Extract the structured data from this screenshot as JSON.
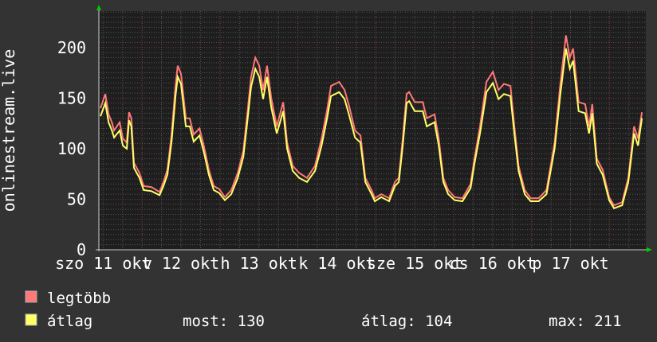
{
  "chart_data": {
    "type": "line",
    "ylabel": "onlinestream.live",
    "ylim": [
      0,
      236
    ],
    "yticks": [
      "0",
      "50",
      "100",
      "150",
      "200"
    ],
    "ytick_values": [
      0,
      50,
      100,
      150,
      200
    ],
    "xunit": "hours since start of graph",
    "xlim": [
      0,
      168.5
    ],
    "day_boundaries_hours": [
      13.3,
      37.3,
      61.3,
      85.3,
      109.3,
      133.3,
      157.3
    ],
    "xticks": [
      "szo 11 okt",
      "v 12 okt",
      "h 13 okt",
      "k 14 okt",
      "sze 15 okt",
      "cs 16 okt",
      "p 17 okt"
    ],
    "xtick_hours": [
      1.3,
      25.3,
      49.3,
      73.3,
      97.3,
      121.3,
      145.3
    ],
    "x": [
      0.5,
      2,
      3,
      4,
      4.7,
      6.4,
      7.4,
      8.6,
      9.3,
      10,
      10.8,
      12.5,
      13.8,
      16.2,
      18.7,
      19.9,
      21.1,
      22.4,
      23.6,
      24.3,
      25.3,
      26.8,
      28,
      29.2,
      31,
      32.4,
      33.9,
      35.4,
      37.1,
      38.8,
      40.8,
      42.8,
      44.5,
      45.7,
      46.9,
      48.2,
      49.4,
      50.6,
      51.8,
      53.1,
      54.8,
      56.8,
      58,
      59.7,
      61.7,
      64.1,
      66.6,
      68.6,
      70.3,
      71.5,
      74,
      75.7,
      77.1,
      78.9,
      80.6,
      82.1,
      84,
      85,
      87,
      89.4,
      91.2,
      92.4,
      93.6,
      94.8,
      95.6,
      97.3,
      99.8,
      101,
      103.4,
      104.7,
      106.1,
      107.6,
      109.6,
      112,
      114.5,
      115.7,
      117.4,
      119.4,
      121.4,
      123.1,
      124.8,
      126.8,
      128,
      129.3,
      131.2,
      133,
      135.5,
      137.9,
      140.4,
      142.1,
      143.9,
      145.1,
      146.1,
      147.8,
      149.8,
      151,
      152,
      153.4,
      155.2,
      157.2,
      158.7,
      161.2,
      163.1,
      164.9,
      166.1,
      167.3
    ],
    "series": [
      {
        "name": "legtöbb",
        "color": "#ff7878",
        "values": [
          140,
          154,
          134,
          126,
          118,
          126,
          110,
          106,
          136,
          130,
          86,
          76,
          63,
          62,
          57,
          67,
          79,
          114,
          162,
          182,
          174,
          130,
          130,
          114,
          120,
          102,
          79,
          63,
          60,
          52,
          59,
          76,
          98,
          134,
          171,
          190,
          182,
          158,
          182,
          150,
          122,
          146,
          106,
          83,
          76,
          71,
          83,
          110,
          138,
          162,
          166,
          158,
          142,
          118,
          113,
          71,
          59,
          51,
          55,
          51,
          67,
          71,
          110,
          154,
          156,
          146,
          146,
          130,
          134,
          110,
          71,
          59,
          52,
          51,
          65,
          90,
          122,
          166,
          176,
          158,
          164,
          162,
          122,
          83,
          59,
          51,
          51,
          59,
          106,
          162,
          212,
          190,
          199,
          146,
          144,
          122,
          144,
          90,
          79,
          52,
          44,
          47,
          71,
          122,
          110,
          136
        ]
      },
      {
        "name": "átlag",
        "color": "#ffff66",
        "values": [
          132,
          145,
          126,
          118,
          111,
          118,
          103,
          100,
          128,
          122,
          81,
          71,
          59,
          58,
          54,
          63,
          74,
          107,
          152,
          171,
          164,
          122,
          122,
          107,
          113,
          96,
          74,
          59,
          56,
          49,
          55,
          71,
          92,
          126,
          161,
          179,
          171,
          149,
          171,
          141,
          115,
          137,
          100,
          78,
          71,
          67,
          78,
          103,
          130,
          152,
          156,
          149,
          133,
          111,
          106,
          67,
          55,
          48,
          52,
          48,
          63,
          67,
          103,
          145,
          147,
          137,
          137,
          122,
          126,
          103,
          67,
          55,
          49,
          48,
          61,
          85,
          115,
          156,
          165,
          149,
          154,
          152,
          115,
          78,
          55,
          48,
          48,
          55,
          100,
          152,
          199,
          179,
          187,
          137,
          135,
          115,
          135,
          85,
          74,
          49,
          41,
          44,
          67,
          115,
          103,
          130
        ]
      }
    ]
  },
  "legend": {
    "max_label": "legtöbb",
    "avg_label": "átlag",
    "max_color": "#ff7878",
    "avg_color": "#ffff66",
    "stats": {
      "now": "most: 130",
      "avg": "átlag: 104",
      "max": "max: 211"
    }
  }
}
